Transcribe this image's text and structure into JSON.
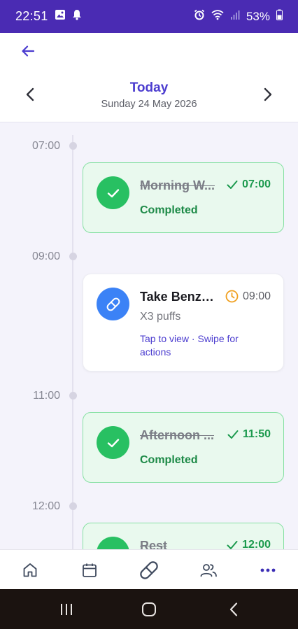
{
  "status_bar": {
    "time": "22:51",
    "battery": "53%"
  },
  "header": {
    "title": "Today",
    "date": "Sunday 24 May 2026"
  },
  "timeline": {
    "hours": [
      "07:00",
      "09:00",
      "11:00",
      "12:00"
    ],
    "items": [
      {
        "title": "Morning W...",
        "time": "07:00",
        "status": "Completed",
        "icon": "check-icon",
        "state": "done"
      },
      {
        "title": "Take Benzo...",
        "time": "09:00",
        "subtitle": "X3 puffs",
        "hint": "Tap to view · Swipe for actions",
        "icon": "pill-icon",
        "state": "pending"
      },
      {
        "title": "Afternoon ...",
        "time": "11:50",
        "status": "Completed",
        "icon": "check-icon",
        "state": "done"
      },
      {
        "title": "Rest",
        "time": "12:00",
        "state": "done"
      }
    ]
  },
  "bottom_nav": [
    "home-icon",
    "calendar-icon",
    "medication-icon",
    "people-icon",
    "more-icon"
  ],
  "colors": {
    "primary": "#4b3ccf",
    "status_bar": "#4a2bb3",
    "success": "#28c062",
    "success_text": "#1d8a47",
    "pill": "#3b82f6",
    "warning": "#f0a020"
  }
}
